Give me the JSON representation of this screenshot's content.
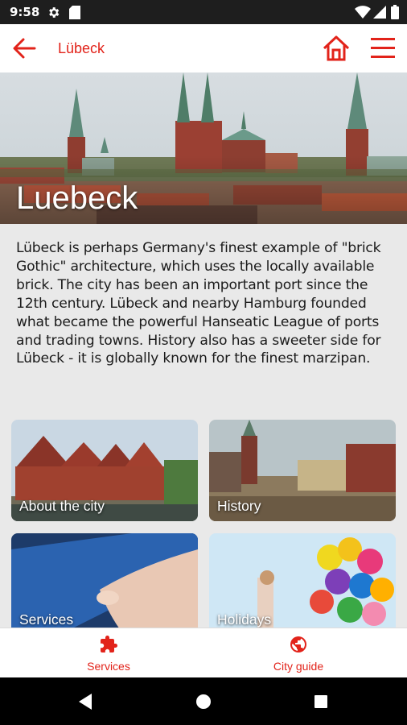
{
  "status_bar": {
    "time": "9:58"
  },
  "app_bar": {
    "title": "Lübeck"
  },
  "hero": {
    "title": "Luebeck"
  },
  "description": "Lübeck is perhaps Germany's finest example of \"brick Gothic\" architecture, which uses the locally available brick. The city has been an important port since the 12th century. Lübeck and nearby Hamburg founded what became the powerful Hanseatic League of ports and trading towns. History also has a sweeter side for Lübeck - it is globally known for the finest marzipan.",
  "tiles": [
    {
      "label": "About the city"
    },
    {
      "label": "History"
    },
    {
      "label": "Services"
    },
    {
      "label": "Holidays"
    }
  ],
  "bottom_nav": [
    {
      "label": "Services",
      "icon": "puzzle-icon"
    },
    {
      "label": "City guide",
      "icon": "globe-icon"
    }
  ],
  "colors": {
    "accent": "#e2231a",
    "status_bar": "#1e1e1e"
  }
}
